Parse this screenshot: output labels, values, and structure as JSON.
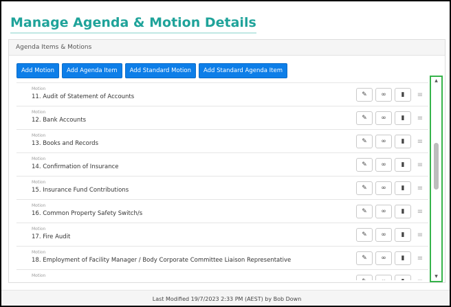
{
  "page": {
    "title": "Manage Agenda & Motion Details"
  },
  "panel": {
    "header": "Agenda Items & Motions",
    "buttons": [
      {
        "label": "Add Motion"
      },
      {
        "label": "Add Agenda Item"
      },
      {
        "label": "Add Standard Motion"
      },
      {
        "label": "Add Standard Agenda Item"
      }
    ]
  },
  "items": [
    {
      "type": "Motion",
      "title": "11.  Audit of Statement of Accounts"
    },
    {
      "type": "Motion",
      "title": "12.  Bank Accounts"
    },
    {
      "type": "Motion",
      "title": "13.  Books and Records"
    },
    {
      "type": "Motion",
      "title": "14.  Confirmation of Insurance"
    },
    {
      "type": "Motion",
      "title": "15.  Insurance Fund Contributions"
    },
    {
      "type": "Motion",
      "title": "16.  Common Property Safety Switch/s"
    },
    {
      "type": "Motion",
      "title": "17.  Fire Audit"
    },
    {
      "type": "Motion",
      "title": "18.  Employment of Facility Manager / Body Corporate Committee Liaison Representative"
    },
    {
      "type": "Motion",
      "title": ""
    }
  ],
  "icons": {
    "edit": "pencil-icon",
    "view": "glasses-icon",
    "delete": "trash-icon",
    "drag": "drag-handle-icon"
  },
  "colors": {
    "title": "#1fa39a",
    "button": "#0d7ee8",
    "highlight": "#35b34a"
  },
  "footer": {
    "text": "Last Modified 19/7/2023 2:33 PM (AEST) by Bob Down"
  }
}
